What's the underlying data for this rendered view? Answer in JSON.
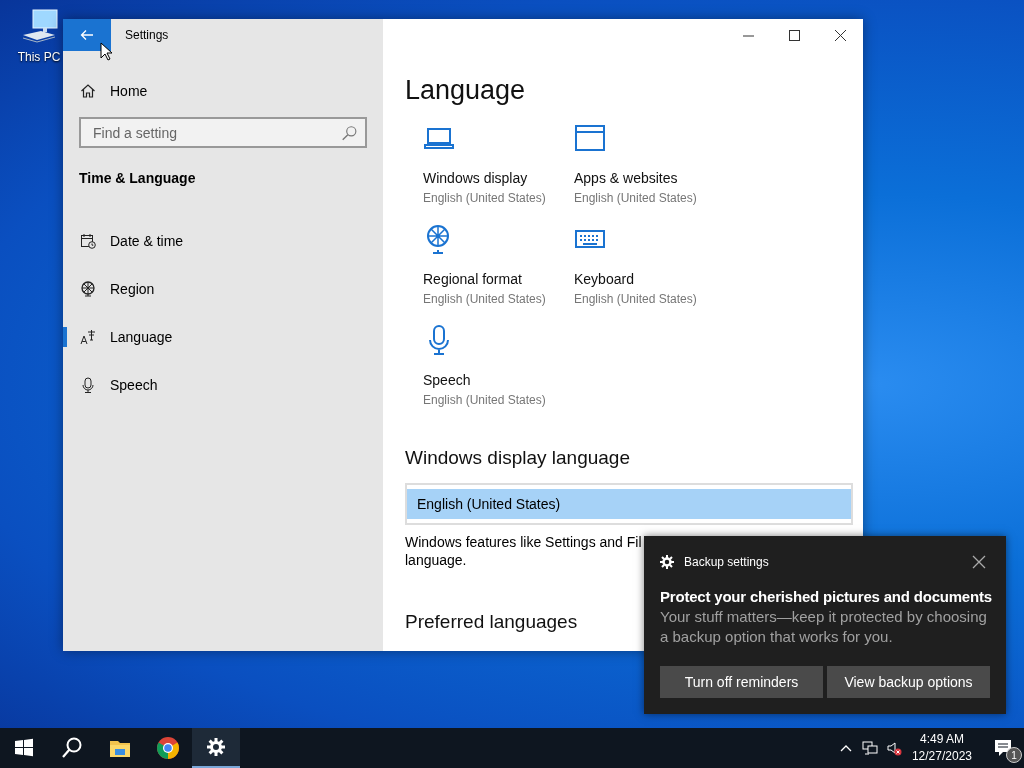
{
  "desktop": {
    "icons": [
      {
        "kind": "computer",
        "label": "This PC"
      }
    ]
  },
  "window": {
    "title": "Settings"
  },
  "sidebar": {
    "home": "Home",
    "search": {
      "placeholder": "Find a setting"
    },
    "section": "Time & Language",
    "items": [
      {
        "kind": "calendar",
        "label": "Date & time",
        "selected": false
      },
      {
        "kind": "globe",
        "label": "Region",
        "selected": false
      },
      {
        "kind": "language",
        "label": "Language",
        "selected": true
      },
      {
        "kind": "mic",
        "label": "Speech",
        "selected": false
      }
    ]
  },
  "content": {
    "title": "Language",
    "tiles": [
      {
        "kind": "laptop",
        "label": "Windows display",
        "value": "English (United States)"
      },
      {
        "kind": "window",
        "label": "Apps & websites",
        "value": "English (United States)"
      },
      {
        "kind": "globe",
        "label": "Regional format",
        "value": "English (United States)"
      },
      {
        "kind": "keyboard",
        "label": "Keyboard",
        "value": "English (United States)"
      },
      {
        "kind": "mic",
        "label": "Speech",
        "value": "English (United States)"
      }
    ],
    "display_language": {
      "heading": "Windows display language",
      "options": [
        {
          "label": "English (United States)",
          "selected": true
        }
      ],
      "description_lines": [
        "Windows features like Settings and Fil",
        "language."
      ]
    },
    "preferred_heading": "Preferred languages"
  },
  "toast": {
    "app": "Backup settings",
    "title": "Protect your cherished pictures and documents",
    "body": "Your stuff matters—keep it protected by choosing a backup option that works for you.",
    "buttons": [
      "Turn off reminders",
      "View backup options"
    ]
  },
  "taskbar": {
    "apps": [
      {
        "kind": "start",
        "active": false
      },
      {
        "kind": "search",
        "active": false
      },
      {
        "kind": "explorer",
        "active": false
      },
      {
        "kind": "chrome",
        "active": false
      },
      {
        "kind": "settings",
        "active": true
      }
    ],
    "time": "4:49 AM",
    "date": "12/27/2023",
    "notifications": "1"
  }
}
